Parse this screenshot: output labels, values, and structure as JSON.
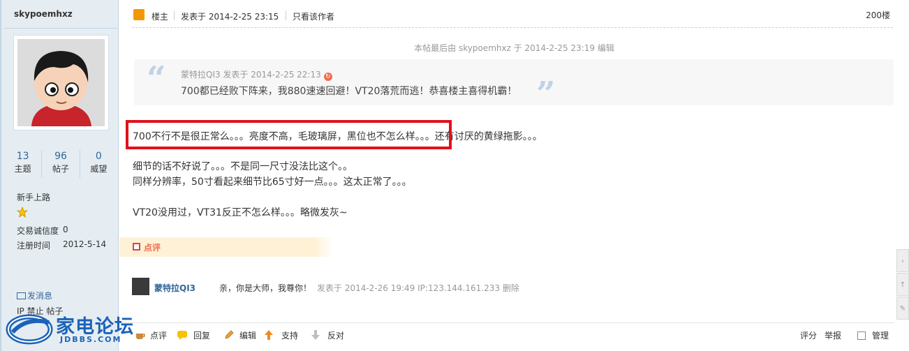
{
  "author": {
    "name": "skypoemhxz",
    "stats": [
      {
        "value": "13",
        "label": "主题"
      },
      {
        "value": "96",
        "label": "帖子"
      },
      {
        "value": "0",
        "label": "威望"
      }
    ],
    "rank": "新手上路",
    "trust_label": "交易诚信度",
    "trust_value": "0",
    "reg_label": "注册时间",
    "reg_value": "2012-5-14",
    "msg_link": "发消息",
    "ban_link": "IP 禁止 帖子"
  },
  "post": {
    "host_label": "楼主",
    "posted": "发表于 2014-2-25 23:15",
    "only_author": "只看该作者",
    "floor": "200楼",
    "edit_note": "本帖最后由 skypoemhxz 于 2014-2-25 23:19 编辑",
    "quote": {
      "open_mark": "“",
      "close_mark": "”",
      "meta": "蒙特拉QI3 发表于 2014-2-25 22:13",
      "text": "700都已经败下阵来，我880速速回避！VT20落荒而逃！恭喜楼主喜得机霸！"
    },
    "body_lines": [
      "700不行不是很正常么。。。亮度不高，毛玻璃屏，黑位也不怎么样。。。还有讨厌的黄绿拖影。。。",
      "细节的话不好说了。。。不是同一尺寸没法比这个。。",
      "同样分辨率，50寸看起来细节比65寸好一点。。。这太正常了。。。",
      "VT20没用过，VT31反正不怎么样。。。略微发灰~"
    ],
    "rate_label": "点评"
  },
  "comment": {
    "user": "蒙特拉QI3",
    "text": "亲，你是大师，我尊你！",
    "meta": "发表于 2014-2-26 19:49 IP:123.144.161.233 删除"
  },
  "actions": {
    "rate": "点评",
    "reply": "回复",
    "edit": "编辑",
    "support": "支持",
    "oppose": "反对",
    "score": "评分",
    "report": "举报",
    "manage": "管理"
  },
  "logo": {
    "title": "家电论坛",
    "sub": "JDBBS.COM"
  },
  "colors": {
    "sidebar_bg": "#e5edf2",
    "link": "#336699",
    "highlight": "#e1101b",
    "rate_bg": "#fff1d6"
  }
}
